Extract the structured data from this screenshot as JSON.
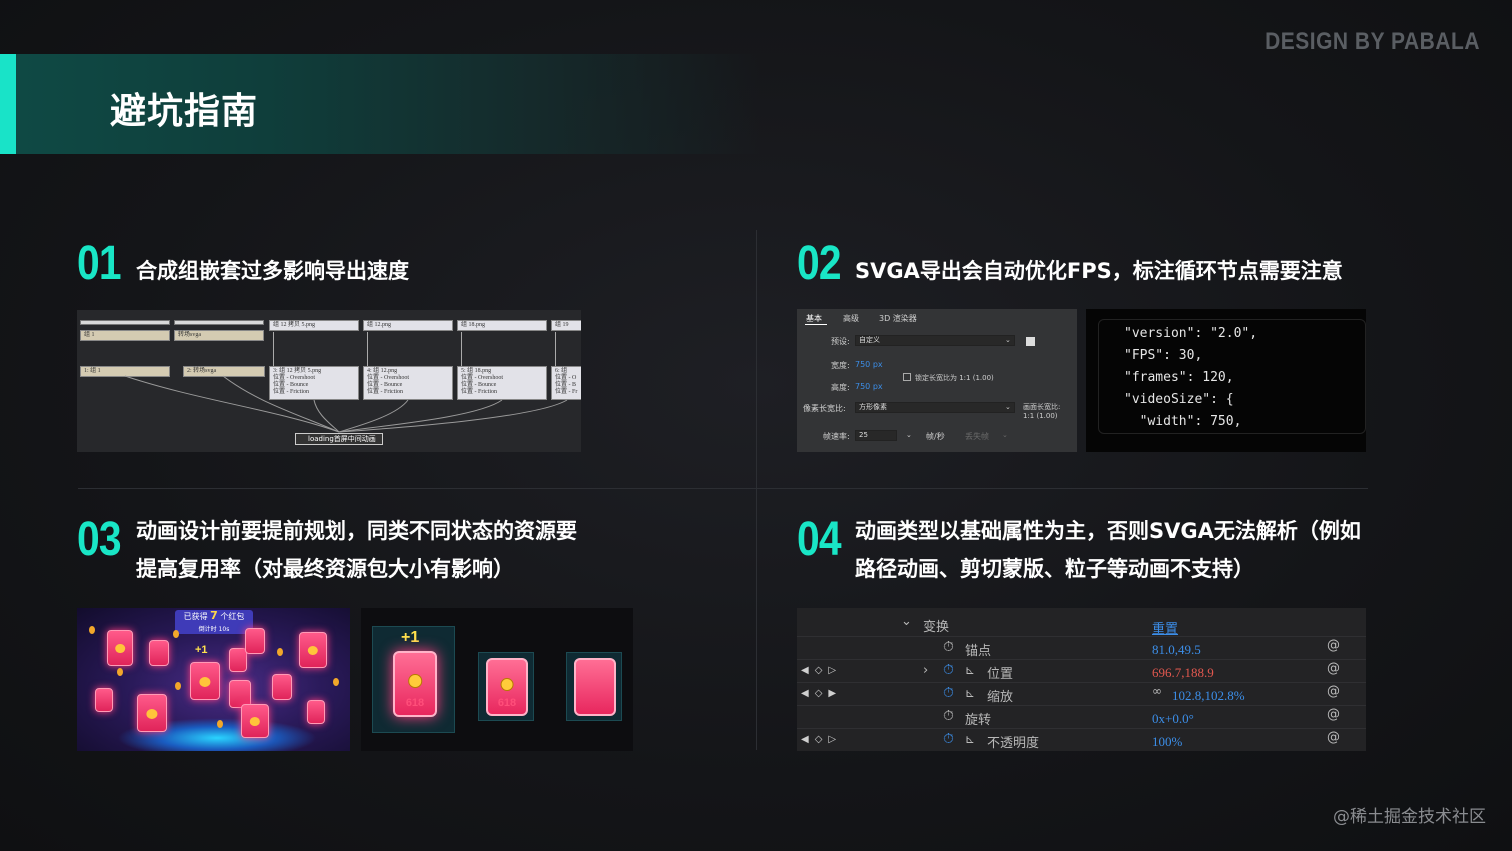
{
  "brand": "DESIGN BY PABALA",
  "header": {
    "title": "避坑指南"
  },
  "sections": [
    {
      "num": "01",
      "title": "合成组嵌套过多影响导出速度"
    },
    {
      "num": "02",
      "title": "SVGA导出会自动优化FPS，标注循环节点需要注意"
    },
    {
      "num": "03",
      "title_line1": "动画设计前要提前规划，同类不同状态的资源要",
      "title_line2": "提高复用率（对最终资源包大小有影响）"
    },
    {
      "num": "04",
      "title_line1": "动画类型以基础属性为主，否则SVGA无法解析（例如",
      "title_line2": "路径动画、剪切蒙版、粒子等动画不支持）"
    }
  ],
  "graph": {
    "top_nodes": [
      "组 12 拷贝 5.png",
      "组 12.png",
      "组 18.png",
      "组 19"
    ],
    "row1": [
      "组 1",
      "转场svga"
    ],
    "row2": [
      "1: 组 1",
      "2: 转场svga"
    ],
    "detail_nodes": [
      {
        "title": "3: 组 12 拷贝 5.png",
        "lines": [
          "位置 - Overshoot",
          "位置 - Bounce",
          "位置 - Friction"
        ]
      },
      {
        "title": "4: 组 12.png",
        "lines": [
          "位置 - Overshoot",
          "位置 - Bounce",
          "位置 - Friction"
        ]
      },
      {
        "title": "5: 组 18.png",
        "lines": [
          "位置 - Overshoot",
          "位置 - Bounce",
          "位置 - Friction"
        ]
      },
      {
        "title": "6: 组",
        "lines": [
          "位置 - O",
          "位置 - B",
          "位置 - Fr"
        ]
      }
    ],
    "output": "loading首屏中间动画"
  },
  "dialog": {
    "tabs": [
      "基本",
      "高级",
      "3D 渲染器"
    ],
    "preset_label": "预设:",
    "preset_value": "自定义",
    "width_label": "宽度:",
    "width_value": "750 px",
    "height_label": "高度:",
    "height_value": "750 px",
    "lock_label": "锁定长宽比为 1:1 (1.00)",
    "pixel_label": "像素长宽比:",
    "pixel_value": "方形像素",
    "frame_aspect_label": "画面长宽比:",
    "frame_aspect_value": "1:1 (1.00)",
    "fps_label": "帧速率:",
    "fps_value": "25",
    "fps_unit": "帧/秒",
    "drop_label": "丢失帧"
  },
  "code_lines": [
    "\"version\": \"2.0\",",
    "\"FPS\": 30,",
    "\"frames\": 120,",
    "\"videoSize\": {",
    "  \"width\": 750,"
  ],
  "game": {
    "bar_prefix": "已获得",
    "bar_count": "7",
    "bar_suffix": "个红包",
    "bar_sub": "倒计时 10s",
    "plus": "+1",
    "env_label": "618"
  },
  "states": {
    "plus": "+1",
    "num": "618"
  },
  "props": {
    "header": "变换",
    "reset": "重置",
    "rows": [
      {
        "label": "锚点",
        "value": "81.0,49.5"
      },
      {
        "label": "位置",
        "value": "696.7,188.9"
      },
      {
        "label": "缩放",
        "value": "102.8,102.8%"
      },
      {
        "label": "旋转",
        "value": "0x+0.0°"
      },
      {
        "label": "不透明度",
        "value": "100%"
      }
    ]
  },
  "footer": "@稀土掘金技术社区"
}
